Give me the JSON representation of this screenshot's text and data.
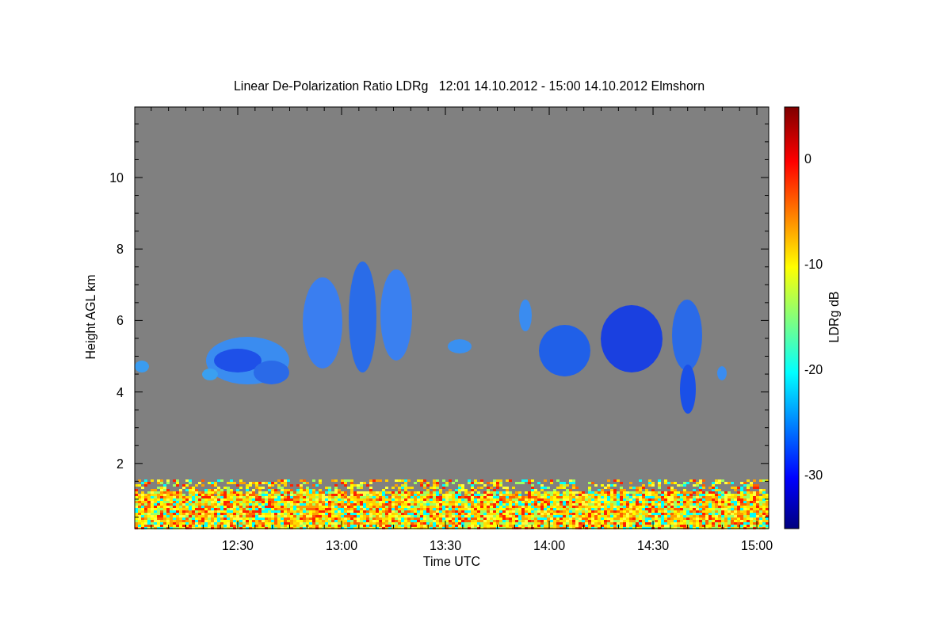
{
  "title": "Linear De-Polarization Ratio LDRg   12:01 14.10.2012 - 15:00 14.10.2012 Elmshorn",
  "y_axis": {
    "label": "Height AGL km",
    "ticks": [
      "10",
      "8",
      "6",
      "4",
      "2"
    ]
  },
  "x_axis": {
    "label": "Time UTC",
    "ticks": [
      "12:30",
      "13:00",
      "13:30",
      "14:00",
      "14:30",
      "15:00"
    ]
  },
  "colorbar": {
    "label": "LDRg dB",
    "ticks": [
      "0",
      "-10",
      "-20",
      "-30"
    ]
  }
}
